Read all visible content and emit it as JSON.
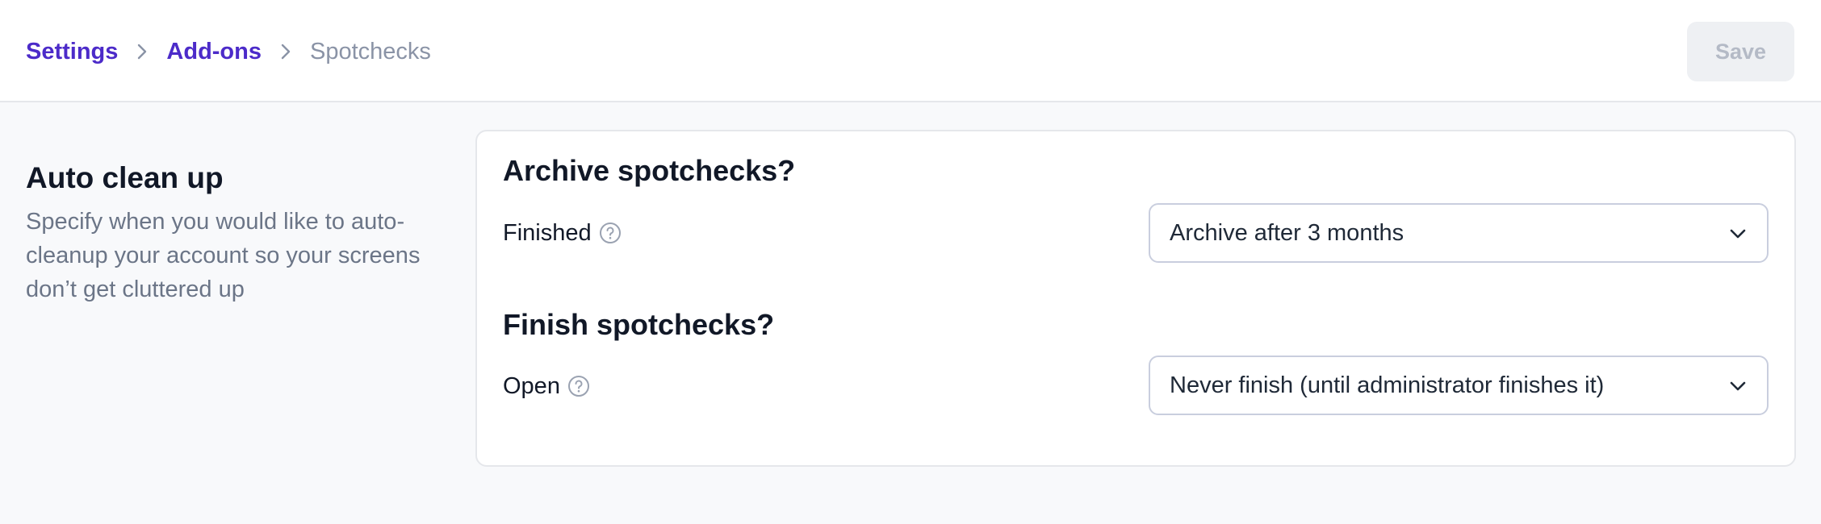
{
  "breadcrumb": {
    "items": [
      {
        "label": "Settings",
        "link": true
      },
      {
        "label": "Add-ons",
        "link": true
      },
      {
        "label": "Spotchecks",
        "link": false
      }
    ]
  },
  "header": {
    "save_label": "Save"
  },
  "section": {
    "title": "Auto clean up",
    "description": "Specify when you would like to auto-cleanup your account so your screens don’t get cluttered up"
  },
  "archive": {
    "title": "Archive spotchecks?",
    "field_label": "Finished",
    "selected": "Archive after 3 months"
  },
  "finish": {
    "title": "Finish spotchecks?",
    "field_label": "Open",
    "selected": "Never finish (until administrator finishes it)"
  },
  "icons": {
    "breadcrumb_separator": "chevron-right-icon",
    "help": "help-circle-icon",
    "dropdown": "chevron-down-icon"
  },
  "colors": {
    "accent": "#4c2bc9",
    "breadcrumb_current": "#8a93a6",
    "muted_text": "#6b7587",
    "page_background": "#f8f9fb",
    "save_disabled_bg": "#eef0f3",
    "save_disabled_text": "#b4bac6"
  }
}
